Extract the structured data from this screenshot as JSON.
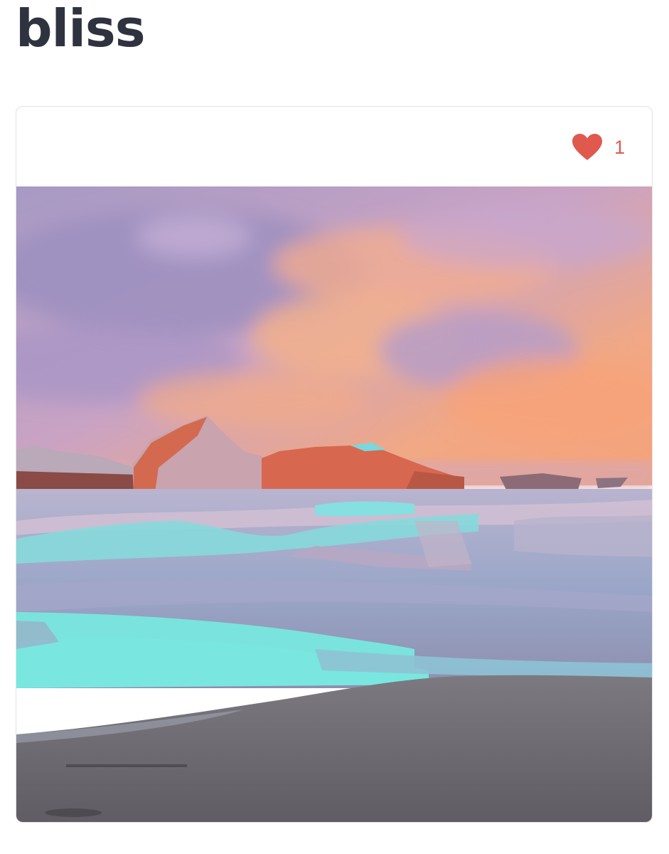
{
  "page": {
    "title": "bliss"
  },
  "post": {
    "likes": {
      "icon": "heart-icon",
      "count": "1",
      "color": "#e0594f"
    },
    "artwork": {
      "palette": {
        "sky_violet": "#a497c2",
        "sky_peach": "#f2a67f",
        "rock_red": "#d96b52",
        "water_turquoise": "#7fe6e0",
        "sand_gray": "#6f6d73"
      }
    }
  }
}
